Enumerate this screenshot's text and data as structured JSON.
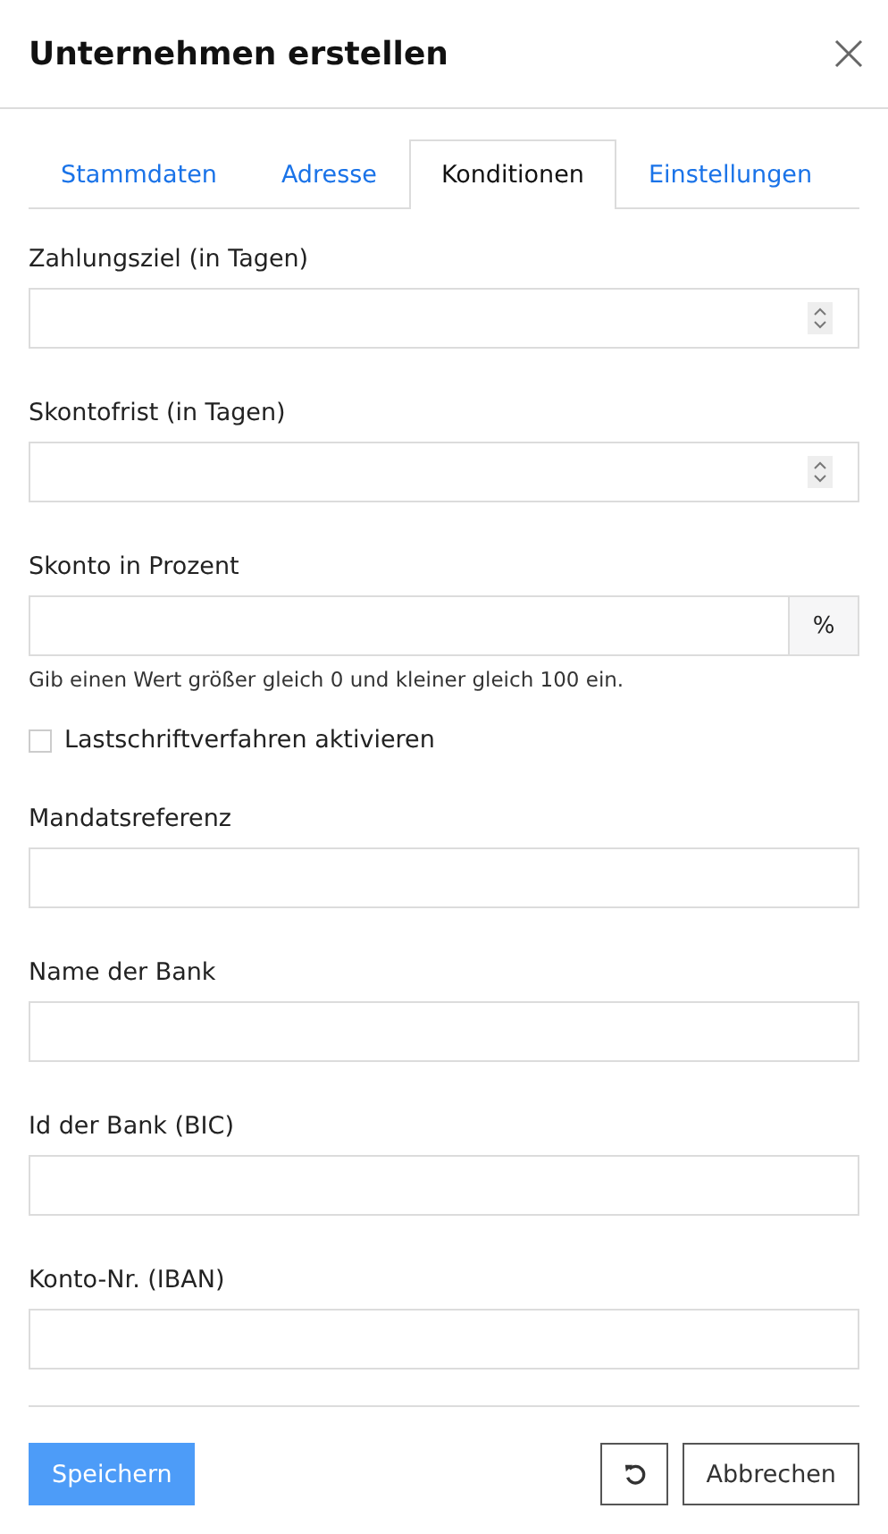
{
  "window": {
    "title": "Unternehmen erstellen"
  },
  "tabs": [
    {
      "label": "Stammdaten",
      "selected": false
    },
    {
      "label": "Adresse",
      "selected": false
    },
    {
      "label": "Konditionen",
      "selected": true
    },
    {
      "label": "Einstellungen",
      "selected": false
    }
  ],
  "fields": [
    {
      "kind": "number",
      "label": "Zahlungsziel (in Tagen)"
    },
    {
      "kind": "number",
      "label": "Skontofrist (in Tagen)"
    },
    {
      "kind": "addon",
      "label": "Skonto in Prozent",
      "addon": "%",
      "help": "Gib einen Wert größer gleich 0 und kleiner gleich 100 ein."
    },
    {
      "kind": "checkbox",
      "label": "Lastschriftverfahren aktivieren",
      "checked": false
    },
    {
      "kind": "text",
      "label": "Mandatsreferenz"
    },
    {
      "kind": "text",
      "label": "Name der Bank"
    },
    {
      "kind": "text",
      "label": "Id der Bank (BIC)"
    },
    {
      "kind": "text",
      "label": "Konto-Nr. (IBAN)"
    }
  ],
  "buttons": {
    "save": "Speichern",
    "cancel": "Abbrechen"
  }
}
